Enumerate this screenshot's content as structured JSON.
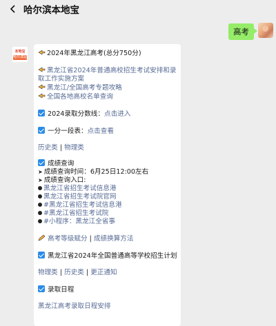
{
  "header": {
    "title": "哈尔滨本地宝"
  },
  "outgoing": {
    "text": "高考"
  },
  "bot_avatar": {
    "top_text": "本地宝",
    "bottom_text": "哈尔滨站"
  },
  "message": {
    "title": "2024年黑龙江高考(总分750分)",
    "links_top": [
      "黑龙江省2024年普通高校招生考试安排和录取工作实施方案",
      "黑龙江/全国高考专题攻略",
      "全国各地高校名单查询"
    ],
    "cutoff": {
      "label": "2024录取分数线：",
      "link": "点击进入"
    },
    "score_table": {
      "label": "一分一段表：",
      "link": "点击查看"
    },
    "categories": {
      "history": "历史类",
      "separator": " | ",
      "physics": "物理类"
    },
    "score_query": {
      "heading": "成绩查询",
      "time": "成绩查询时间：6月25日12:00左右",
      "entry_label": "成绩查询入口:",
      "entries": [
        "黑龙江省招生考试信息港",
        "黑龙江省招生考试院官网",
        "#黑龙江省招生考试信息港",
        "#黑龙江省招生考试院",
        "#小程序：黑龙江全省事"
      ]
    },
    "grade_links": {
      "first": "高考等级赋分",
      "separator": " | ",
      "second": "成绩换算方法"
    },
    "plan": {
      "heading": "黑龙江省2024年全国普通高等学校招生计划"
    },
    "plan_links": {
      "physics": "物理类",
      "history": "历史类",
      "update": "更正通知",
      "separator": " | "
    },
    "schedule": {
      "heading": "录取日程",
      "link": "黑龙江高考录取日程安排"
    }
  }
}
